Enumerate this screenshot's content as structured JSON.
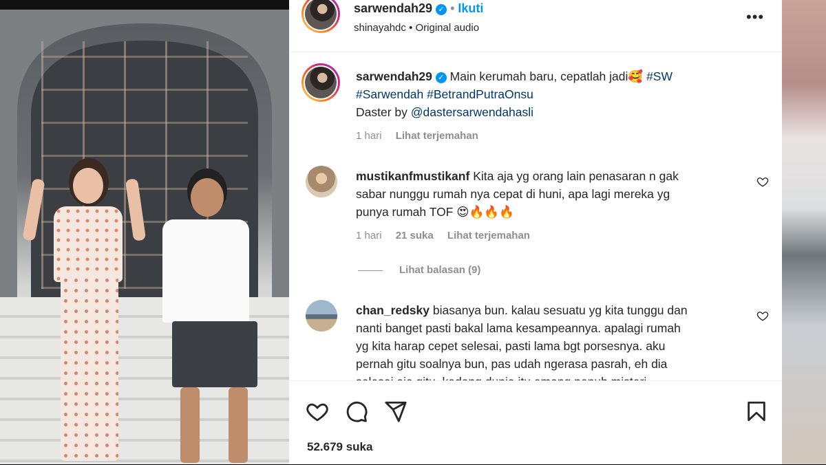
{
  "post": {
    "username": "sarwendah29",
    "follow_label": "Ikuti",
    "audio_account": "shinayahdc",
    "audio_label": "Original audio",
    "caption_text": "Main kerumah baru, cepatlah jadi🥰",
    "caption_tag_1": "#SW",
    "caption_tag_2": "#Sarwendah",
    "caption_tag_3": "#BetrandPutraOnsu",
    "caption_line3_prefix": "Daster by",
    "caption_mention": "@dastersarwendahasli",
    "caption_time": "1 hari",
    "caption_translate": "Lihat terjemahan",
    "likes": "52.679 suka"
  },
  "comments": [
    {
      "username": "mustikanfmustikanf",
      "line1": "Kita aja yg orang lain penasaran n gak",
      "line2": "sabar nunggu rumah nya cepat di huni, apa lagi mereka yg",
      "line3": "punya rumah TOF 😍🔥🔥🔥",
      "time": "1 hari",
      "likes": "21 suka",
      "translate": "Lihat terjemahan",
      "replies": "Lihat balasan (9)"
    },
    {
      "username": "chan_redsky",
      "line1": "biasanya bun. kalau sesuatu yg kita tunggu dan",
      "line2": "nanti banget pasti bakal lama kesampeannya. apalagi rumah",
      "line3": "yg kita harap cepet selesai, pasti lama bgt porsesnya. aku",
      "line4": "pernah gitu soalnya bun, pas udah ngerasa pasrah, eh dia",
      "line5": "selesai aja gitu. kadang dunia itu emang penuh misteri"
    }
  ],
  "icons": {
    "like": "heart-icon",
    "comment": "comment-icon",
    "share": "paper-plane-icon",
    "save": "bookmark-icon",
    "options": "more-icon",
    "verified": "verified-badge-icon"
  },
  "colors": {
    "link_blue": "#0095f6",
    "mention": "#00376b",
    "muted": "#8e8e8e",
    "text": "#262626"
  }
}
